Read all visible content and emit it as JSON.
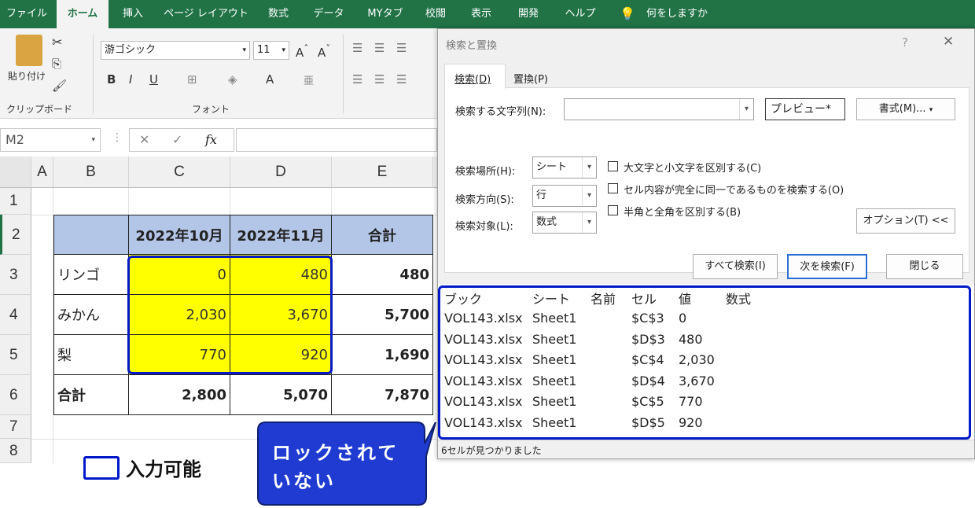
{
  "menu": {
    "tabs": [
      "ファイル",
      "ホーム",
      "挿入",
      "ページ レイアウト",
      "数式",
      "データ",
      "MYタブ",
      "校閲",
      "表示",
      "開発",
      "ヘルプ"
    ],
    "tell_me": "何をしますか"
  },
  "ribbon": {
    "paste": "貼り付け",
    "clipboard": "クリップボード",
    "font_name": "游ゴシック",
    "font_size": "11",
    "font_group": "フォント"
  },
  "formula": {
    "name_box": "M2",
    "fx": "fx"
  },
  "columns": [
    "A",
    "B",
    "C",
    "D",
    "E"
  ],
  "rows": [
    "1",
    "2",
    "3",
    "4",
    "5",
    "6",
    "7",
    "8"
  ],
  "table": {
    "headers": [
      "2022年10月",
      "2022年11月",
      "合計"
    ],
    "items": [
      {
        "label": "リンゴ",
        "oct": "0",
        "nov": "480",
        "total": "480"
      },
      {
        "label": "みかん",
        "oct": "2,030",
        "nov": "3,670",
        "total": "5,700"
      },
      {
        "label": "梨",
        "oct": "770",
        "nov": "920",
        "total": "1,690"
      }
    ],
    "sum": {
      "label": "合計",
      "oct": "2,800",
      "nov": "5,070",
      "total": "7,870"
    }
  },
  "legend": {
    "label": "入力可能"
  },
  "callout": {
    "line1": "ロックされて",
    "line2": "いない"
  },
  "dialog": {
    "title": "検索と置換",
    "help": "?",
    "close_x": "✕",
    "tab_find": "検索(D)",
    "tab_replace": "置換(P)",
    "find_label": "検索する文字列(N):",
    "preview": "プレビュー*",
    "format_btn": "書式(M)...",
    "within_label": "検索場所(H):",
    "within_value": "シート",
    "search_label": "検索方向(S):",
    "search_value": "行",
    "lookin_label": "検索対象(L):",
    "lookin_value": "数式",
    "opt1": "大文字と小文字を区別する(C)",
    "opt2": "セル内容が完全に同一であるものを検索する(O)",
    "opt3": "半角と全角を区別する(B)",
    "options_btn": "オプション(T) <<",
    "find_all": "すべて検索(I)",
    "find_next": "次を検索(F)",
    "close_btn": "閉じる",
    "result_headers": [
      "ブック",
      "シート",
      "名前",
      "セル",
      "値",
      "数式"
    ],
    "results": [
      {
        "book": "VOL143.xlsx",
        "sheet": "Sheet1",
        "cell": "$C$3",
        "value": "0"
      },
      {
        "book": "VOL143.xlsx",
        "sheet": "Sheet1",
        "cell": "$D$3",
        "value": "480"
      },
      {
        "book": "VOL143.xlsx",
        "sheet": "Sheet1",
        "cell": "$C$4",
        "value": "2,030"
      },
      {
        "book": "VOL143.xlsx",
        "sheet": "Sheet1",
        "cell": "$D$4",
        "value": "3,670"
      },
      {
        "book": "VOL143.xlsx",
        "sheet": "Sheet1",
        "cell": "$C$5",
        "value": "770"
      },
      {
        "book": "VOL143.xlsx",
        "sheet": "Sheet1",
        "cell": "$D$5",
        "value": "920"
      }
    ],
    "status": "6セルが見つかりました"
  },
  "colors": {
    "excel_green": "#217346",
    "header_fill": "#b4c6e7",
    "input_fill": "#ffff00",
    "highlight_border": "#0019c8",
    "callout_fill": "#1f3bd1"
  }
}
